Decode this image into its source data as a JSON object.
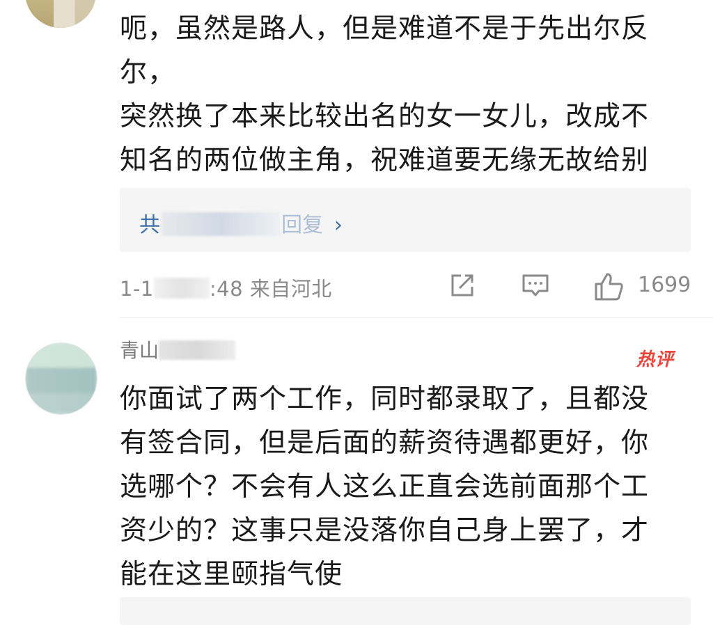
{
  "comments": [
    {
      "text": "呃，虽然是路人，但是难道不是于先出尔反尔，\n突然换了本来比较出名的女一女儿，改成不\n知名的两位做主角，祝难道要无缘无故给别\n人做配吗",
      "emoji": "laughing-tears-emoji",
      "reply_prefix": "共",
      "reply_suffix": "回复",
      "reply_chevron": "›",
      "time": "1-1",
      "time_tail": ":48",
      "location": "来自河北",
      "likes": "1699"
    },
    {
      "username_prefix": "青山",
      "badge": "热评",
      "text": "你面试了两个工作，同时都录取了，且都没\n有签合同，但是后面的薪资待遇都更好，你\n选哪个？不会有人这么正直会选前面那个工\n资少的？这事只是没落你自己身上罢了，才\n能在这里颐指气使"
    }
  ],
  "colors": {
    "link": "#3f6fa9",
    "meta": "#8a8a8a",
    "hot": "#e8453c",
    "reply_bg": "#f5f5f5"
  },
  "icons": [
    "share-icon",
    "comment-icon",
    "like-icon"
  ]
}
